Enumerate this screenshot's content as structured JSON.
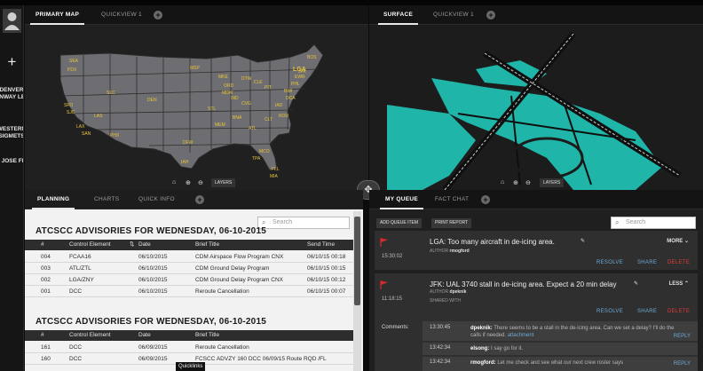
{
  "rail": {
    "items": [
      "DENVER RUNWAY LEFT",
      "WESTERN SIGMETS",
      "SAN JOSE FLOW"
    ]
  },
  "map_panel": {
    "tabs": [
      {
        "label": "PRIMARY MAP",
        "active": true
      },
      {
        "label": "QUICKVIEW 1",
        "active": false
      }
    ],
    "layers_label": "LAYERS",
    "airports": [
      "SEA",
      "PDX",
      "SFO",
      "SJC",
      "LAX",
      "SAN",
      "LAS",
      "SLC",
      "PHX",
      "DEN",
      "MSP",
      "ORD",
      "MDW",
      "DTW",
      "BOS",
      "LGA",
      "EWR",
      "PHL",
      "BWI",
      "DCA",
      "IAD",
      "PIT",
      "CLE",
      "CVG",
      "STL",
      "BNA",
      "CLT",
      "ATL",
      "MEM",
      "DFW",
      "IAH",
      "MCO",
      "TPA",
      "FLL",
      "MIA",
      "MKE",
      "ROU",
      "IND",
      "JFK"
    ],
    "highlight_airport": "LGA"
  },
  "surface_panel": {
    "tabs": [
      {
        "label": "SURFACE",
        "active": true
      },
      {
        "label": "QUICKVIEW 1",
        "active": false
      }
    ],
    "layers_label": "LAYERS",
    "accent": "#1fb5a8"
  },
  "planning": {
    "tabs": [
      {
        "label": "PLANNING",
        "active": true
      },
      {
        "label": "CHARTS",
        "active": false
      },
      {
        "label": "QUICK INFO",
        "active": false
      }
    ],
    "search_placeholder": "Search",
    "sections": [
      {
        "title": "ATCSCC ADVISORIES FOR WEDNESDAY, 06-10-2015",
        "columns": [
          "#",
          "Control Element",
          "Date",
          "Brief Title",
          "Send Time"
        ],
        "rows": [
          [
            "004",
            "FCAA16",
            "06/10/2015",
            "CDM Airspace Flow Program CNX",
            "06/10/15 00:18"
          ],
          [
            "003",
            "ATL/ZTL",
            "06/10/2015",
            "CDM Ground Delay Program",
            "06/10/15 00:15"
          ],
          [
            "002",
            "LGA/ZNY",
            "06/10/2015",
            "CDM Ground Delay Program CNX",
            "06/10/15 00:12"
          ],
          [
            "001",
            "DCC",
            "06/10/2015",
            "Reroute Cancellation",
            "06/10/15 00:07"
          ]
        ]
      },
      {
        "title": "ATCSCC ADVISORIES FOR WEDNESDAY, 06-10-2015",
        "columns": [
          "#",
          "Control Element",
          "Date",
          "Brief Title",
          "Send Time"
        ],
        "rows": [
          [
            "161",
            "DCC",
            "06/09/2015",
            "Reroute Cancellation",
            ""
          ],
          [
            "160",
            "DCC",
            "06/09/2015",
            "FCSCC ADVZY 160 DCC 06/09/15 Route RQD /FL",
            ""
          ]
        ]
      }
    ],
    "tooltip": "Quicklinks"
  },
  "queue": {
    "tabs": [
      {
        "label": "MY QUEUE",
        "active": true
      },
      {
        "label": "FACT CHAT",
        "active": false
      }
    ],
    "add_item_label": "ADD QUEUE ITEM",
    "print_label": "PRINT REPORT",
    "search_placeholder": "Search",
    "items": [
      {
        "title": "LGA: Too many aircraft in de-icing area.",
        "time": "15:30:02",
        "author_label": "AUTHOR",
        "author": "rmogford",
        "toggle": "MORE",
        "actions": [
          "RESOLVE",
          "SHARE",
          "DELETE"
        ]
      },
      {
        "title": "JFK: UAL 3740 stall in de-icing area. Expect a 20 min delay",
        "time": "11:18:15",
        "author_label": "AUTHOR",
        "author": "dpeknik",
        "shared_label": "SHARED WITH",
        "toggle": "LESS",
        "actions": [
          "RESOLVE",
          "SHARE",
          "DELETE"
        ],
        "comments_label": "Comments:",
        "comments": [
          {
            "time": "13:30:45",
            "user": "dpeknik:",
            "text": "There seems to be a stall in the de-icing area. Can we set a delay? I'll do the calls if needed.",
            "attachment": "attachment",
            "reply": "REPLY"
          },
          {
            "time": "13:42:34",
            "user": "elsong:",
            "text": "I say go for it.",
            "attachment": "",
            "reply": ""
          },
          {
            "time": "13:42:34",
            "user": "rmogford:",
            "text": "Let me check and see what our next crew roster says",
            "attachment": "",
            "reply": "REPLY"
          }
        ]
      }
    ],
    "flag_color": "#d62b2b"
  }
}
